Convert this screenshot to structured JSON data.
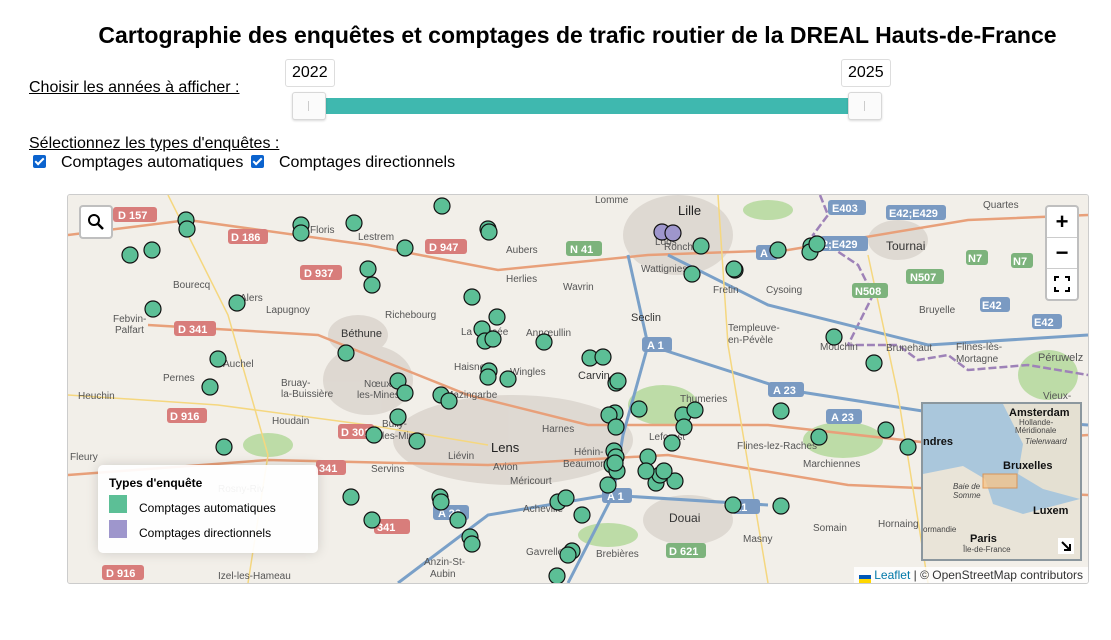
{
  "title": "Cartographie des enquêtes et comptages de trafic routier de la DREAL Hauts-de-France",
  "years": {
    "label": "Choisir les années à afficher :",
    "min": "2022",
    "max": "2025"
  },
  "types": {
    "label": "Sélectionnez les types d'enquêtes :",
    "items": [
      {
        "label": "Comptages automatiques",
        "checked": true
      },
      {
        "label": "Comptages directionnels",
        "checked": true
      }
    ]
  },
  "map": {
    "zoom_in": "+",
    "zoom_out": "−",
    "fullscreen_icon": "fullscreen-icon",
    "search_icon": "magnifier-icon",
    "legend": {
      "title": "Types d'enquête",
      "items": [
        {
          "label": "Comptages automatiques",
          "color": "#5cbf96"
        },
        {
          "label": "Comptages directionnels",
          "color": "#9e96cc"
        }
      ]
    },
    "attribution": {
      "leaflet": "Leaflet",
      "osm": "| © OpenStreetMap contributors"
    },
    "colors": {
      "auto": "#5cbf96",
      "directional": "#9e96cc",
      "slider": "#3fb8af"
    },
    "places": [
      "Lille",
      "Loos",
      "Ronchin",
      "Wattignies",
      "Lomme",
      "Tournai",
      "Quartes",
      "Fretin",
      "Cysoing",
      "Seclin",
      "Templeuve-en-Pévèle",
      "Mouchin",
      "Brunehaut",
      "Bruyelle",
      "Fies-lès-Mortagne",
      "Péruwelz",
      "Vieux-",
      "Béthune",
      "Richebourg",
      "La Bassée",
      "Annœullin",
      "Haisnes",
      "Wingles",
      "Carvin",
      "Nœux-les-Mines",
      "Mazingarbe",
      "Bully-les-Mines",
      "Lens",
      "Liévin",
      "Avion",
      "Harnes",
      "Hénin-Beaumont",
      "Leforest",
      "Thumeries",
      "Flines-lez-Raches",
      "Marchiennes",
      "Douai",
      "Somain",
      "Hornaing",
      "Auchel",
      "Bruay-la-Buissière",
      "Houdain",
      "Servins",
      "Fleury",
      "Bourecq",
      "Febvin-Palfart",
      "Pernes",
      "Heuchin",
      "Floris",
      "Lestrem",
      "Aubers",
      "Herlies",
      "Wavrin",
      "Lapugnoy",
      "Méricourt",
      "Acheville",
      "Gavrelle",
      "Brebières",
      "Masny",
      "Izel-les-Hameau",
      "Anzin-St-Aubin",
      "Rosny-Riv",
      "Beuvry",
      "Alers",
      "Flers"
    ],
    "roads": [
      "D 157",
      "D 186",
      "D 947",
      "N 41",
      "D 937",
      "D 341",
      "A 1",
      "A 23",
      "D 916",
      "D 301",
      "D 341",
      "D 939",
      "A 26",
      "D 621",
      "D 916",
      "A 21",
      "E42;E429",
      "E403",
      "N507",
      "N7",
      "N508",
      "E42",
      "A 1",
      "D 341"
    ],
    "minimap": {
      "labels": [
        "Amsterdam",
        "Hollande-Méridionale",
        "Tielerwaard",
        "Londres",
        "Bruxelles",
        "Baie de Somme",
        "Luxem",
        "Paris",
        "Île-de-France",
        "Normandie"
      ]
    }
  },
  "markers_auto": [
    [
      62,
      60
    ],
    [
      118,
      25
    ],
    [
      119,
      34
    ],
    [
      84,
      55
    ],
    [
      233,
      30
    ],
    [
      286,
      28
    ],
    [
      233,
      38
    ],
    [
      337,
      53
    ],
    [
      300,
      74
    ],
    [
      304,
      90
    ],
    [
      374,
      11
    ],
    [
      420,
      34
    ],
    [
      421,
      37
    ],
    [
      169,
      108
    ],
    [
      85,
      114
    ],
    [
      150,
      164
    ],
    [
      142,
      192
    ],
    [
      156,
      252
    ],
    [
      278,
      158
    ],
    [
      330,
      186
    ],
    [
      337,
      198
    ],
    [
      373,
      200
    ],
    [
      381,
      206
    ],
    [
      330,
      222
    ],
    [
      306,
      240
    ],
    [
      349,
      246
    ],
    [
      404,
      102
    ],
    [
      414,
      134
    ],
    [
      429,
      122
    ],
    [
      417,
      146
    ],
    [
      425,
      144
    ],
    [
      421,
      176
    ],
    [
      440,
      184
    ],
    [
      420,
      182
    ],
    [
      476,
      147
    ],
    [
      522,
      163
    ],
    [
      535,
      162
    ],
    [
      548,
      188
    ],
    [
      550,
      186
    ],
    [
      547,
      218
    ],
    [
      541,
      220
    ],
    [
      548,
      232
    ],
    [
      546,
      256
    ],
    [
      544,
      270
    ],
    [
      549,
      276
    ],
    [
      548,
      262
    ],
    [
      547,
      268
    ],
    [
      571,
      214
    ],
    [
      615,
      220
    ],
    [
      627,
      215
    ],
    [
      616,
      232
    ],
    [
      604,
      248
    ],
    [
      580,
      262
    ],
    [
      588,
      288
    ],
    [
      592,
      280
    ],
    [
      607,
      286
    ],
    [
      578,
      276
    ],
    [
      596,
      276
    ],
    [
      540,
      290
    ],
    [
      490,
      307
    ],
    [
      498,
      303
    ],
    [
      514,
      320
    ],
    [
      372,
      302
    ],
    [
      373,
      307
    ],
    [
      283,
      302
    ],
    [
      304,
      325
    ],
    [
      390,
      325
    ],
    [
      402,
      342
    ],
    [
      404,
      349
    ],
    [
      504,
      356
    ],
    [
      500,
      360
    ],
    [
      489,
      381
    ],
    [
      633,
      51
    ],
    [
      667,
      75
    ],
    [
      710,
      55
    ],
    [
      743,
      51
    ],
    [
      742,
      57
    ],
    [
      624,
      79
    ],
    [
      713,
      311
    ],
    [
      665,
      310
    ],
    [
      749,
      49
    ],
    [
      766,
      142
    ],
    [
      806,
      168
    ],
    [
      713,
      216
    ],
    [
      751,
      242
    ],
    [
      818,
      235
    ],
    [
      840,
      252
    ],
    [
      666,
      74
    ]
  ],
  "markers_dir": [
    [
      594,
      37
    ],
    [
      605,
      38
    ]
  ]
}
